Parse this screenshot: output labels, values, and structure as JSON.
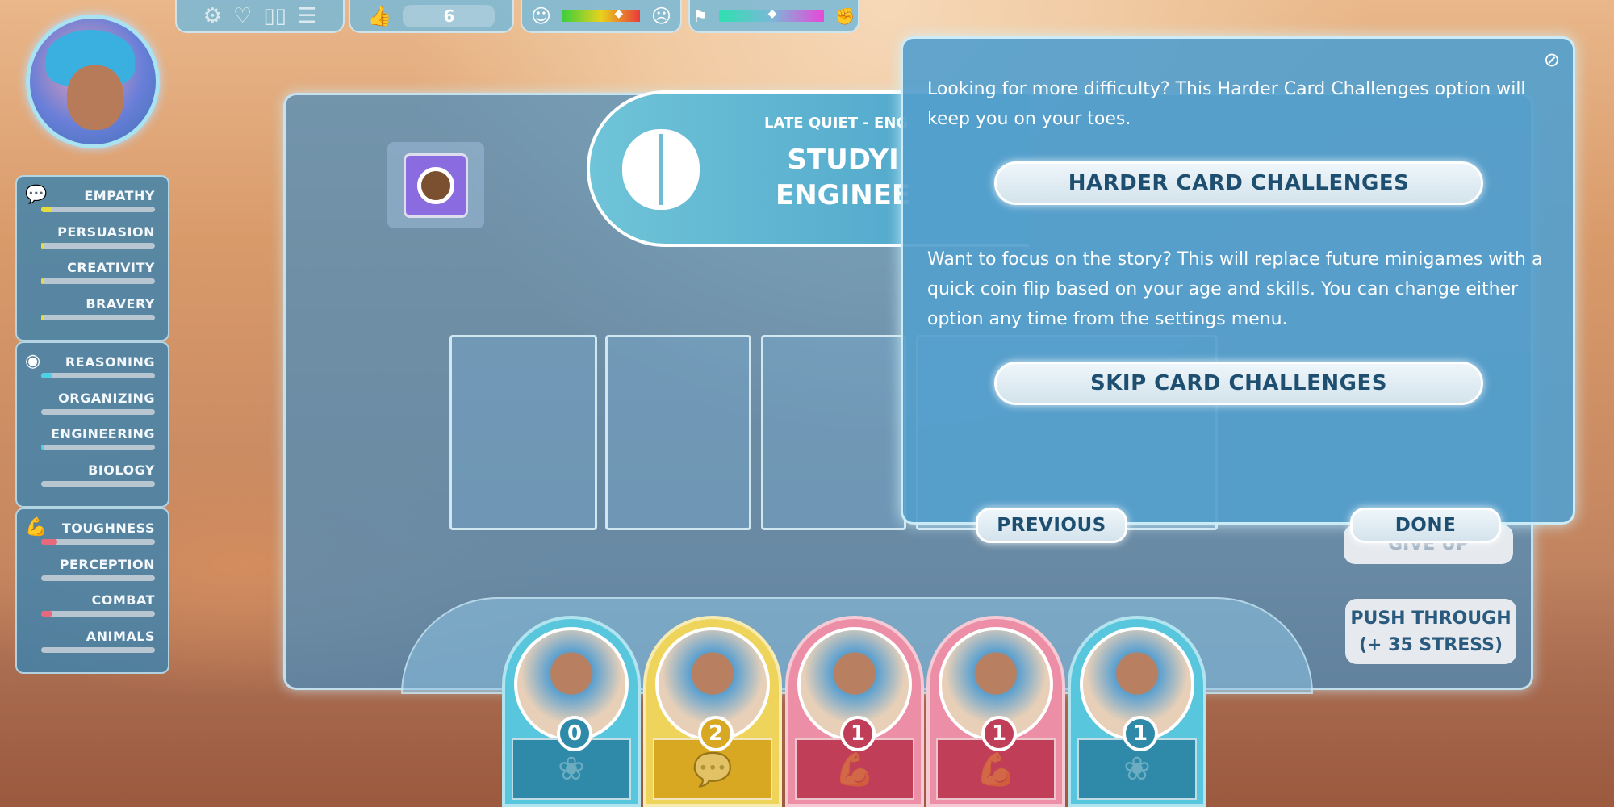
{
  "top_bar": {
    "icons": [
      "gear-icon",
      "heart-icon",
      "cards-icon",
      "menu-icon"
    ],
    "likes": "6",
    "mood_meter": {
      "left_icon": "happy-face-icon",
      "right_icon": "sad-face-icon",
      "value_percent": 73
    },
    "stance_meter": {
      "left_icon": "flag-icon",
      "right_icon": "fist-icon",
      "value_percent": 51
    }
  },
  "skills": {
    "groups": [
      {
        "icon": "speech-bubble-icon",
        "color": "#e6dc3c",
        "items": [
          {
            "label": "EMPATHY",
            "fill": 0.1
          },
          {
            "label": "PERSUASION",
            "fill": 0.02
          },
          {
            "label": "CREATIVITY",
            "fill": 0.02
          },
          {
            "label": "BRAVERY",
            "fill": 0.02
          }
        ]
      },
      {
        "icon": "brain-icon",
        "color": "#4fd0e8",
        "items": [
          {
            "label": "REASONING",
            "fill": 0.1
          },
          {
            "label": "ORGANIZING",
            "fill": 0
          },
          {
            "label": "ENGINEERING",
            "fill": 0.03
          },
          {
            "label": "BIOLOGY",
            "fill": 0
          }
        ]
      },
      {
        "icon": "muscle-icon",
        "color": "#e8687c",
        "items": [
          {
            "label": "TOUGHNESS",
            "fill": 0.14
          },
          {
            "label": "PERCEPTION",
            "fill": 0
          },
          {
            "label": "COMBAT",
            "fill": 0.1
          },
          {
            "label": "ANIMALS",
            "fill": 0
          }
        ]
      }
    ]
  },
  "banner": {
    "subtitle": "LATE QUIET - ENG",
    "title_line1": "STUDYI",
    "title_line2": "ENGINEE"
  },
  "dialog": {
    "text1": "Looking for more difficulty? This Harder Card Challenges option will keep you on your toes.",
    "harder_button": "HARDER CARD CHALLENGES",
    "text2": "Want to focus on the story? This will replace future minigames with a quick coin flip based on your age and skills. You can change either option any time from the settings menu.",
    "skip_button": "SKIP CARD CHALLENGES",
    "close_icon": "hide-icon"
  },
  "previous_button": "PREVIOUS",
  "done_button": "DONE",
  "give_up_button": "GIVE UP",
  "push_through_button": "PUSH THROUGH\n(+ 35 STRESS)",
  "hand": [
    {
      "value": "0",
      "type": "brain",
      "color": "#58c6dc",
      "dark": "#2e8aa8",
      "icon": "brain-icon"
    },
    {
      "value": "2",
      "type": "speech",
      "color": "#eed45a",
      "dark": "#d8a822",
      "icon": "speech-bubble-icon"
    },
    {
      "value": "1",
      "type": "muscle",
      "color": "#ec8ea6",
      "dark": "#c03e58",
      "icon": "muscle-icon"
    },
    {
      "value": "1",
      "type": "muscle",
      "color": "#ec8ea6",
      "dark": "#c03e58",
      "icon": "muscle-icon"
    },
    {
      "value": "1",
      "type": "brain",
      "color": "#58c6dc",
      "dark": "#2e8aa8",
      "icon": "brain-icon"
    }
  ]
}
